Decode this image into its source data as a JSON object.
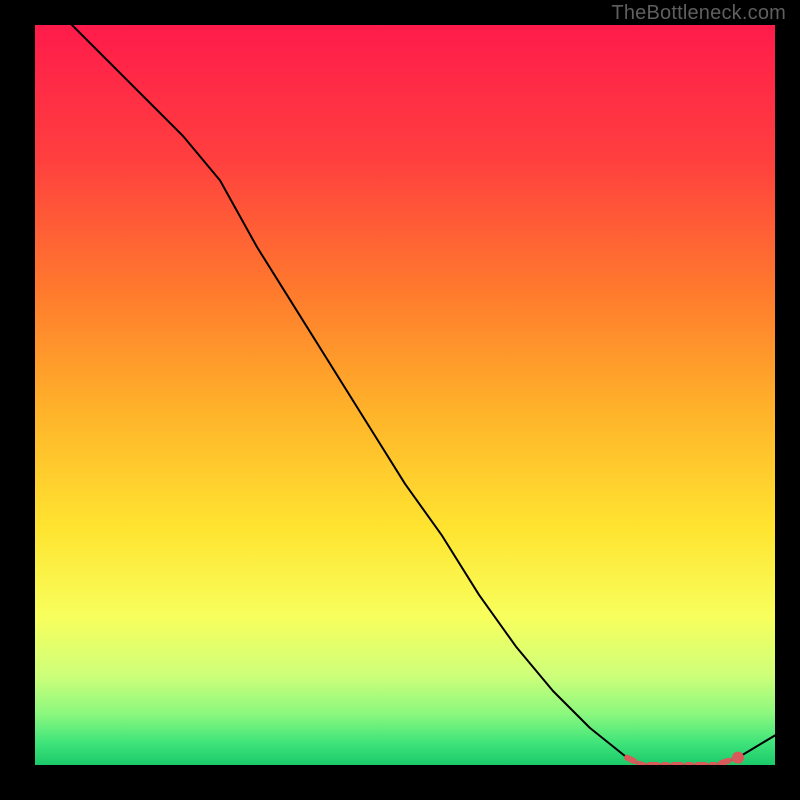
{
  "watermark": "TheBottleneck.com",
  "chart_data": {
    "type": "line",
    "title": "",
    "xlabel": "",
    "ylabel": "",
    "xlim": [
      0,
      100
    ],
    "ylim": [
      0,
      100
    ],
    "series": [
      {
        "name": "main-curve",
        "x": [
          0,
          5,
          10,
          15,
          20,
          25,
          30,
          35,
          40,
          45,
          50,
          55,
          60,
          65,
          70,
          75,
          80,
          82,
          85,
          88,
          90,
          92,
          95,
          100
        ],
        "y": [
          106,
          100,
          95,
          90,
          85,
          79,
          70,
          62,
          54,
          46,
          38,
          31,
          23,
          16,
          10,
          5,
          1,
          0,
          0,
          0,
          0,
          0,
          1,
          4
        ]
      },
      {
        "name": "highlight",
        "x": [
          80,
          82,
          85,
          88,
          90,
          92,
          95
        ],
        "y": [
          1,
          0,
          0,
          0,
          0,
          0,
          1
        ]
      },
      {
        "name": "highlight-dot",
        "x": [
          95
        ],
        "y": [
          1
        ]
      }
    ],
    "gradient_stops": [
      {
        "offset": 0.0,
        "color": "#ff1b4b"
      },
      {
        "offset": 0.18,
        "color": "#ff3f3f"
      },
      {
        "offset": 0.36,
        "color": "#ff7a2d"
      },
      {
        "offset": 0.52,
        "color": "#ffb22a"
      },
      {
        "offset": 0.68,
        "color": "#ffe430"
      },
      {
        "offset": 0.8,
        "color": "#f8ff5d"
      },
      {
        "offset": 0.88,
        "color": "#cdff7a"
      },
      {
        "offset": 0.93,
        "color": "#8cf87e"
      },
      {
        "offset": 0.97,
        "color": "#3fe47a"
      },
      {
        "offset": 1.0,
        "color": "#1bc96a"
      }
    ],
    "colors": {
      "curve": "#000000",
      "highlight": "#d85a5a",
      "highlight_dashes": [
        8,
        6,
        4,
        6,
        8,
        6,
        4,
        6
      ]
    }
  }
}
